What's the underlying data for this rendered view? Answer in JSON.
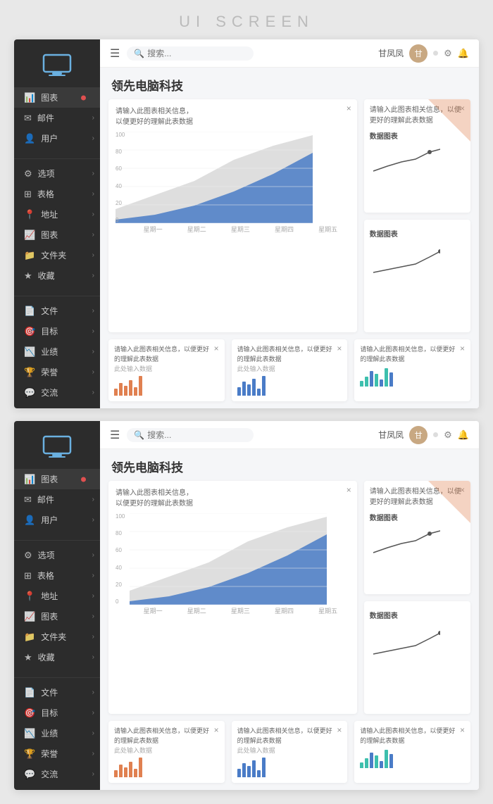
{
  "page": {
    "title": "UI  SCREEN"
  },
  "panels": [
    {
      "id": "panel1",
      "topbar": {
        "search_placeholder": "搜索...",
        "user_name": "甘凤凤",
        "avatar_text": "甘"
      },
      "heading": "领先电脑科技",
      "sidebar": {
        "logo_label": "Monitor",
        "groups": [
          {
            "items": [
              {
                "label": "图表",
                "icon": "chart-icon",
                "has_dot": true,
                "active": true
              },
              {
                "label": "邮件",
                "icon": "mail-icon",
                "has_arrow": true
              },
              {
                "label": "用户",
                "icon": "user-icon",
                "has_arrow": true
              }
            ]
          },
          {
            "items": [
              {
                "label": "选项",
                "icon": "option-icon",
                "has_arrow": true
              },
              {
                "label": "表格",
                "icon": "table-icon",
                "has_arrow": true
              },
              {
                "label": "地址",
                "icon": "location-icon",
                "has_arrow": true
              },
              {
                "label": "图表",
                "icon": "chart2-icon",
                "has_arrow": true
              },
              {
                "label": "文件夹",
                "icon": "folder-icon",
                "has_arrow": true
              },
              {
                "label": "收藏",
                "icon": "star-icon",
                "has_arrow": true
              }
            ]
          },
          {
            "items": [
              {
                "label": "文件",
                "icon": "file-icon",
                "has_arrow": true
              },
              {
                "label": "目标",
                "icon": "target-icon",
                "has_arrow": true
              },
              {
                "label": "业绩",
                "icon": "perf-icon",
                "has_arrow": true
              },
              {
                "label": "荣誉",
                "icon": "honor-icon",
                "has_arrow": true
              },
              {
                "label": "交流",
                "icon": "chat-icon",
                "has_arrow": true
              }
            ]
          }
        ]
      },
      "main_chart": {
        "desc": "请输入此图表相关信息，以便更好的理解此表数据",
        "y_labels": [
          "100",
          "80",
          "60",
          "40",
          "20",
          "0"
        ],
        "x_labels": [
          "星期一",
          "星期二",
          "星期三",
          "星期四",
          "星期五"
        ]
      },
      "side_cards": [
        {
          "desc": "请输入此图表相关信息，以便更好的理解此表数据",
          "label": "数据图表"
        },
        {
          "desc": "",
          "label": "数据图表"
        }
      ],
      "bottom_cards": [
        {
          "desc": "请输入此图表相关信息，以便更好的理解此表数据",
          "input_label": "此处输入数据",
          "type": "bars"
        },
        {
          "desc": "请输入此图表相关信息，以便更好的理解此表数据",
          "input_label": "此处输入数据",
          "type": "bars"
        },
        {
          "desc": "请输入此图表相关信息，以便更好的理解此表数据",
          "input_label": "",
          "type": "bars_colored"
        }
      ]
    }
  ],
  "colors": {
    "sidebar_bg": "#2c2c2c",
    "blue_area": "#4a7cc7",
    "gray_area": "#c8c8c8",
    "orange": "#e08050",
    "teal": "#3dbfad",
    "bar_orange": "#e08050",
    "bar_blue": "#4a7cc7",
    "bar_teal": "#3dbfad"
  }
}
